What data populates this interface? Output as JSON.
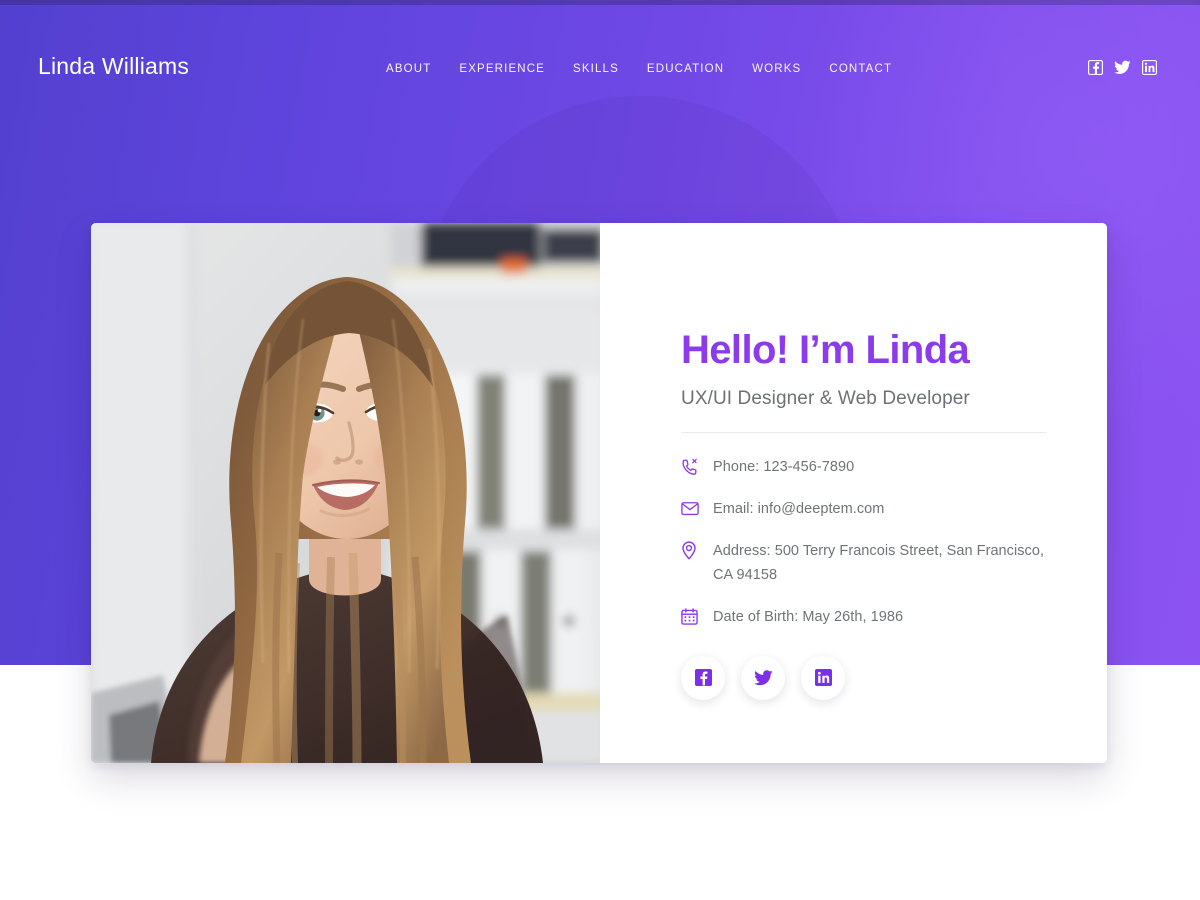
{
  "site": {
    "brand": "Linda Williams",
    "accent_purple": "#8C3BEA",
    "hero_gradient_from": "#5340CF",
    "hero_gradient_to": "#8C53F2"
  },
  "nav": {
    "items": [
      {
        "label": "ABOUT",
        "icon": "nav-about"
      },
      {
        "label": "EXPERIENCE",
        "icon": "nav-experience"
      },
      {
        "label": "SKILLS",
        "icon": "nav-skills"
      },
      {
        "label": "EDUCATION",
        "icon": "nav-education"
      },
      {
        "label": "WORKS",
        "icon": "nav-works"
      },
      {
        "label": "CONTACT",
        "icon": "nav-contact"
      }
    ],
    "social": [
      {
        "name": "facebook-icon"
      },
      {
        "name": "twitter-icon"
      },
      {
        "name": "linkedin-icon"
      }
    ]
  },
  "hero": {
    "photo_alt": "portrait-photo-of-linda",
    "heading": "Hello! I’m Linda",
    "subheading": "UX/UI Designer & Web Developer",
    "contacts": [
      {
        "icon": "phone-icon",
        "text": "Phone: 123-456-7890"
      },
      {
        "icon": "envelope-icon",
        "text": "Email: info@deeptem.com"
      },
      {
        "icon": "location-pin-icon",
        "text": "Address: 500 Terry Francois Street, San Francisco, CA 94158"
      },
      {
        "icon": "calendar-icon",
        "text": "Date of Birth: May 26th, 1986"
      }
    ],
    "social": [
      {
        "name": "facebook-icon"
      },
      {
        "name": "twitter-icon"
      },
      {
        "name": "linkedin-icon"
      }
    ]
  }
}
